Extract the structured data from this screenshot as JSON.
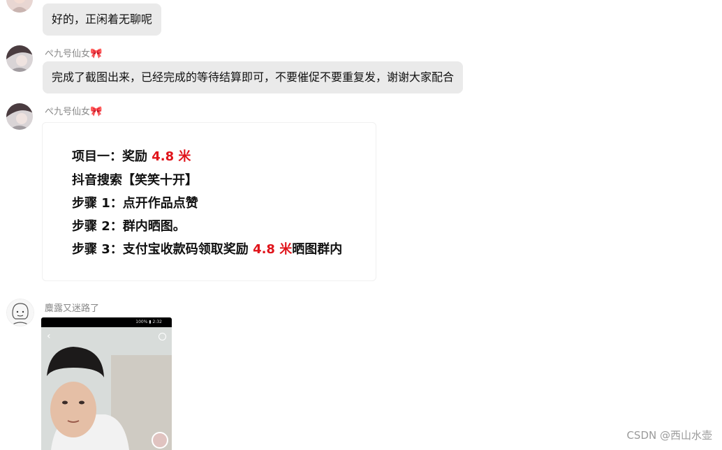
{
  "messages": [
    {
      "text": "好的，正闲着无聊呢"
    },
    {
      "sender": "ぺ九号仙女",
      "text": "完成了截图出来，已经完成的等待结算即可，不要催促不要重复发，谢谢大家配合"
    },
    {
      "sender": "ぺ九号仙女",
      "card": {
        "line1_prefix": "项目一：奖励 ",
        "line1_amount": "4.8 米",
        "line2": "抖音搜索【笑笑十开】",
        "line3": "步骤 1：点开作品点赞",
        "line4": "步骤 2：群内晒图。",
        "line5_prefix": "步骤 3：支付宝收款码领取奖励 ",
        "line5_amount": "4.8 米",
        "line5_suffix": "晒图群内"
      }
    },
    {
      "sender": "麋露又迷路了",
      "screenshot": {
        "status_right": "100% ▮ 2:32"
      }
    }
  ],
  "decor": {
    "bow": "🎀"
  },
  "watermark": "CSDN @西山水壶",
  "colors": {
    "bubble": "#eaeaea",
    "accent_red": "#e0141b",
    "sender": "#888888"
  },
  "icons": [
    "avatar-photo",
    "back-arrow-icon",
    "search-icon",
    "bow-emoji"
  ]
}
